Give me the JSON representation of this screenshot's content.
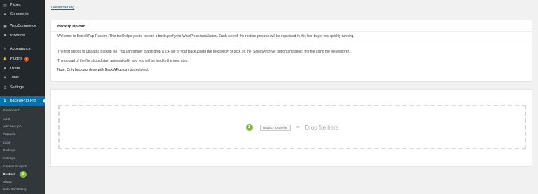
{
  "sidebar": {
    "items": [
      {
        "label": "Pages",
        "icon": "pages-icon",
        "glyph": "▤"
      },
      {
        "label": "Comments",
        "icon": "comments-icon",
        "glyph": "▰"
      },
      {
        "label": "WooCommerce",
        "icon": "woocommerce-icon",
        "glyph": "▣"
      },
      {
        "label": "Products",
        "icon": "products-icon",
        "glyph": "■"
      },
      {
        "label": "Appearance",
        "icon": "appearance-icon",
        "glyph": "✎"
      },
      {
        "label": "Plugins",
        "icon": "plugins-icon",
        "glyph": "⚡",
        "badge": "1"
      },
      {
        "label": "Users",
        "icon": "users-icon",
        "glyph": "●"
      },
      {
        "label": "Tools",
        "icon": "tools-icon",
        "glyph": "✦"
      },
      {
        "label": "Settings",
        "icon": "settings-icon",
        "glyph": "⚙"
      }
    ],
    "backwpup": {
      "label": "BackWPup Pro",
      "glyph": "❂"
    },
    "submenu": [
      {
        "label": "Dashboard"
      },
      {
        "label": "Jobs"
      },
      {
        "label": "Add new job"
      },
      {
        "label": "Wizards"
      },
      {
        "label": "Logs"
      },
      {
        "label": "Backups"
      },
      {
        "label": "Settings"
      },
      {
        "label": "Contact Support"
      },
      {
        "label": "Restore",
        "current": true
      },
      {
        "label": "About"
      },
      {
        "label": "Help BackWPup"
      }
    ],
    "restore_step": "1",
    "colors": {
      "bg": "#23282d",
      "active": "#0073aa",
      "submenu_bg": "#32373c",
      "step": "#7fba3c"
    }
  },
  "main": {
    "download_log": "Download log",
    "panel": {
      "title": "Backup Upload",
      "intro": "Welcome to BackWPup Restore. This tool helps you to restore a backup of your WordPress installation. Each step of the restore process will be explained in this box to get you quickly running.",
      "p1": "The first step is to upload a backup file. You can simply drag'n'drop a ZIP file of your backup into the box below or click on the 'Select Archive' button and select the file using the file explorer.",
      "p2": "The upload of the file should start automatically and you will be lead to the next step.",
      "note": "Note: Only backups done with BackWPup can be restored."
    },
    "upload": {
      "step": "2",
      "select_archive": "SELECT ARCHIVE",
      "or": "or",
      "drop_text": "Drop file here"
    }
  }
}
